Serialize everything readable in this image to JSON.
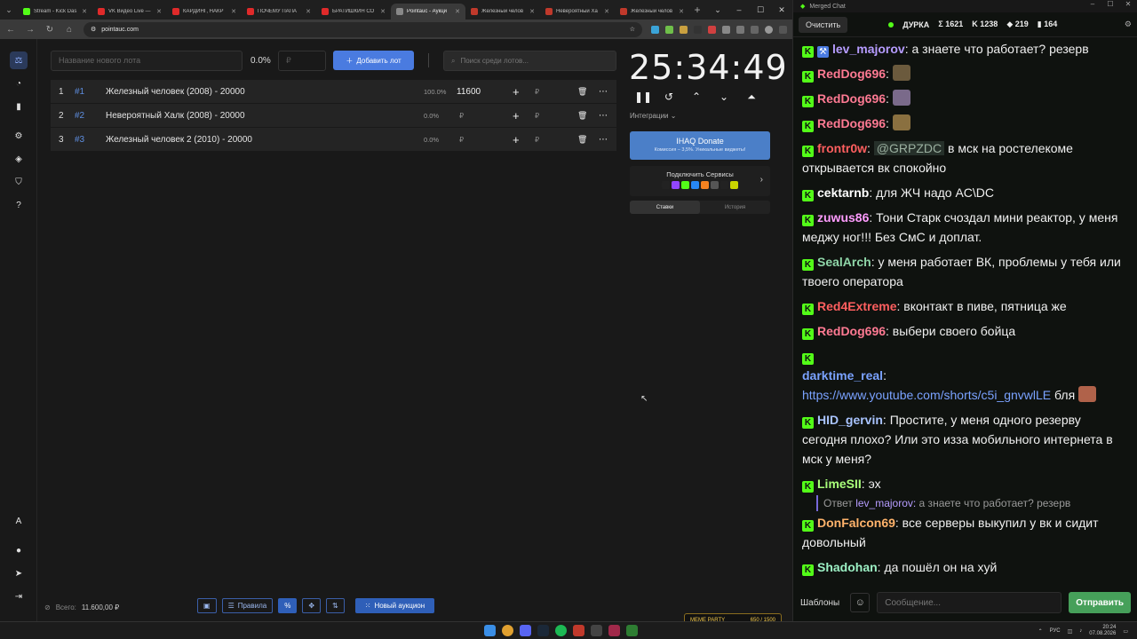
{
  "browser": {
    "tabs": [
      {
        "title": "Stream - Kick Das",
        "color": "#53fc18",
        "active": false
      },
      {
        "title": "VK Видео Live —",
        "color": "#e02a2a",
        "active": false
      },
      {
        "title": "КАРДИНГ, НАКР",
        "color": "#e02a2a",
        "active": false
      },
      {
        "title": "ПОЧЕМУ ПАПА",
        "color": "#e02a2a",
        "active": false
      },
      {
        "title": "БРАТИШКИН СО",
        "color": "#e02a2a",
        "active": false
      },
      {
        "title": "Pointauc - Аукци",
        "color": "#888888",
        "active": true
      },
      {
        "title": "Железный челов",
        "color": "#c0392b",
        "active": false
      },
      {
        "title": "Невероятный Ха",
        "color": "#c0392b",
        "active": false
      },
      {
        "title": "Железный челов",
        "color": "#c0392b",
        "active": false
      }
    ],
    "url": "pointauc.com"
  },
  "auction": {
    "new_lot_placeholder": "Название нового лота",
    "percent": "0.0%",
    "amount_placeholder": "₽",
    "add_lot_label": "Добавить лот",
    "search_placeholder": "Поиск среди лотов...",
    "lots": [
      {
        "index": "1",
        "id": "#1",
        "name": "Железный человек (2008) - 20000",
        "percent": "100.0%",
        "amount": "11600",
        "currency": "₽"
      },
      {
        "index": "2",
        "id": "#2",
        "name": "Невероятный Халк (2008) - 20000",
        "percent": "0.0%",
        "amount": "",
        "currency": "₽"
      },
      {
        "index": "3",
        "id": "#3",
        "name": "Железный человек 2 (2010) - 20000",
        "percent": "0.0%",
        "amount": "",
        "currency": "₽"
      }
    ],
    "timer": "25:34:49",
    "integrations_label": "Интеграции",
    "donate": {
      "title": "IHAQ Donate",
      "subtitle": "Комиссия – 3,5%. Уникальные виджеты!"
    },
    "connect_title": "Подключить Сервисы",
    "tabs": [
      "Ставки",
      "История"
    ],
    "total_label": "Всего:",
    "total_value": "11.600,00 ₽",
    "footer": {
      "rules": "Правила",
      "new_auction": "Новый аукцион"
    }
  },
  "chat": {
    "window_title": "Merged Chat",
    "clear_label": "Очистить",
    "channel": "ДУРКА",
    "stats": [
      {
        "icon": "Σ",
        "value": "1621"
      },
      {
        "icon": "K",
        "value": "1238"
      },
      {
        "icon": "◆",
        "value": "219"
      },
      {
        "icon": "▮",
        "value": "164"
      }
    ],
    "messages": [
      {
        "user": "lev_majorov",
        "color": "#b69cff",
        "text": ": а знаете что работает? резерв",
        "badge": true
      },
      {
        "user": "RedDog696",
        "color": "#ff7a93",
        "text": ":",
        "emote": "#6b5a3d"
      },
      {
        "user": "RedDog696",
        "color": "#ff7a93",
        "text": ":",
        "emote": "#7a6a8a"
      },
      {
        "user": "RedDog696",
        "color": "#ff7a93",
        "text": ":",
        "emote": "#8a7040"
      },
      {
        "user": "frontr0w",
        "color": "#ff5f5f",
        "text": ": @GRPZDC в мск на ростелекоме открывается вк спокойно",
        "mention": "@GRPZDC"
      },
      {
        "user": "cektarnb",
        "color": "#ffffff",
        "text": ": для ЖЧ надо AC\\DC"
      },
      {
        "user": "zuwus86",
        "color": "#ff9cff",
        "text": ": Тони Старк счоздал мини реактор, у меня меджу ног!!! Без СмС и доплат."
      },
      {
        "user": "SealArch",
        "color": "#8fd6a8",
        "text": ": у меня работает ВК, проблемы у тебя или твоего оператора"
      },
      {
        "user": "Red4Extreme",
        "color": "#ff5f5f",
        "text": ": вконтакт в пиве, пятница же"
      },
      {
        "user": "RedDog696",
        "color": "#ff7a93",
        "text": ": выбери своего бойца"
      },
      {
        "user": "darktime_real",
        "color": "#7aa2ff",
        "text": ": ",
        "link": "https://www.youtube.com/shorts/c5i_gnvwlLE",
        "after": " бля",
        "emote": "#b0624a",
        "newline": true
      },
      {
        "user": "HID_gervin",
        "color": "#a9c4ff",
        "text": ": Простите, у меня одного резерву сегодня плохо? Или это изза мобильного интернета в мск у меня?"
      },
      {
        "user": "LimeSII",
        "color": "#a9ff7a",
        "text": ": эх"
      },
      {
        "user": "DonFalcon69",
        "color": "#ffb36b",
        "text": ": все серверы выкупил у вк и сидит довольный",
        "reply": {
          "prefix": "Ответ",
          "user": "lev_majorov:",
          "text": " а знаете что работает? резерв"
        }
      },
      {
        "user": "Shadohan",
        "color": "#9cf0c4",
        "text": ": да пошёл он на хуй"
      }
    ],
    "templates_label": "Шаблоны",
    "input_placeholder": "Сообщение...",
    "send_label": "Отправить"
  },
  "taskbar": {
    "meme_label": "MEME PARTY",
    "meme_score": "650 / 1500",
    "lang": "РУС",
    "time": "20:24",
    "date": "07.08.2026"
  }
}
